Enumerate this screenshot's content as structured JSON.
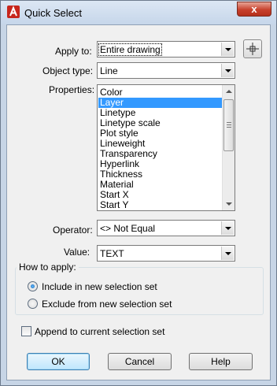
{
  "window": {
    "title": "Quick Select",
    "close_label": "x"
  },
  "form": {
    "apply_to": {
      "label": "Apply to:",
      "value": "Entire drawing"
    },
    "object_type": {
      "label": "Object type:",
      "value": "Line"
    },
    "properties": {
      "label": "Properties:",
      "items": [
        "Color",
        "Layer",
        "Linetype",
        "Linetype scale",
        "Plot style",
        "Lineweight",
        "Transparency",
        "Hyperlink",
        "Thickness",
        "Material",
        "Start X",
        "Start Y"
      ],
      "selected": "Layer"
    },
    "operator": {
      "label": "Operator:",
      "value": "<> Not Equal"
    },
    "value": {
      "label": "Value:",
      "value": "TEXT"
    }
  },
  "how_to_apply": {
    "title": "How to apply:",
    "include_label": "Include in new selection set",
    "exclude_label": "Exclude from new selection set",
    "selected": "include"
  },
  "append": {
    "label": "Append to current selection set",
    "checked": false
  },
  "buttons": {
    "ok": "OK",
    "cancel": "Cancel",
    "help": "Help"
  },
  "icons": {
    "app": "autocad-a-icon",
    "pick": "select-objects-crosshair-icon"
  },
  "colors": {
    "selection": "#3399ff",
    "title_bar": "#c6d6ea",
    "close": "#c7412c"
  }
}
